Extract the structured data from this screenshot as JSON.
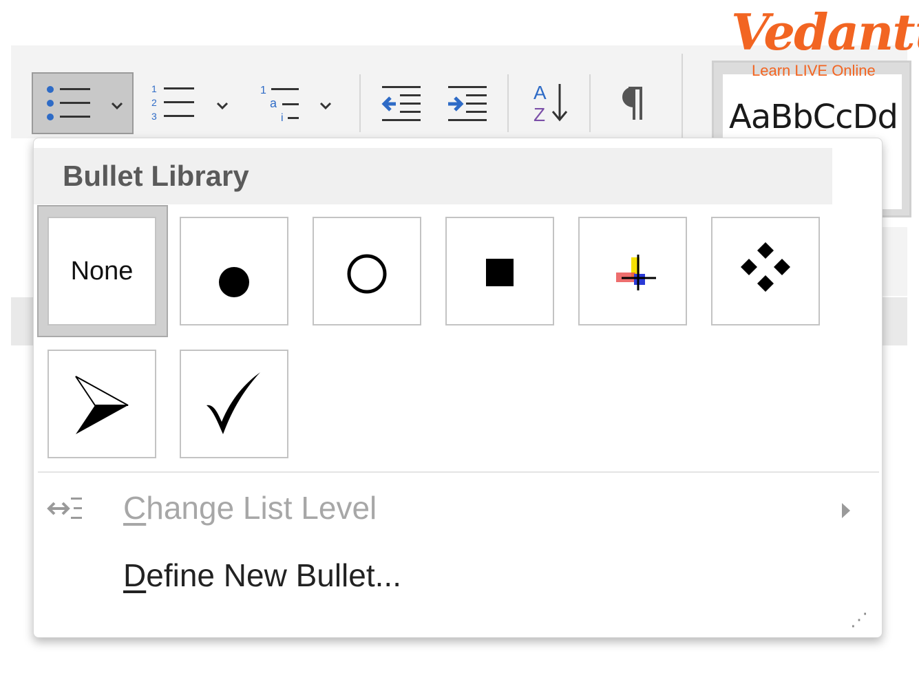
{
  "logo": {
    "name": "Vedantu",
    "tagline": "Learn LIVE Online"
  },
  "toolbar": {
    "bullets_label": "Bullets",
    "style_sample": "AaBbCcDd"
  },
  "bullet_library": {
    "heading": "Bullet Library",
    "items": [
      {
        "name": "none",
        "label": "None"
      },
      {
        "name": "filled-circle"
      },
      {
        "name": "hollow-circle"
      },
      {
        "name": "filled-square"
      },
      {
        "name": "four-color-cross"
      },
      {
        "name": "four-diamonds"
      },
      {
        "name": "arrowhead"
      },
      {
        "name": "checkmark"
      }
    ],
    "selected": "none"
  },
  "menu": {
    "change_level": {
      "first": "C",
      "rest": "hange List Level",
      "enabled": false
    },
    "define_new": {
      "first": "D",
      "rest": "efine New Bullet...",
      "enabled": true
    }
  },
  "colors": {
    "accent_blue": "#2e6bc6",
    "sort_purple": "#7b4fa8",
    "logo_orange": "#f26522",
    "disabled_text": "#a7a7a7"
  }
}
